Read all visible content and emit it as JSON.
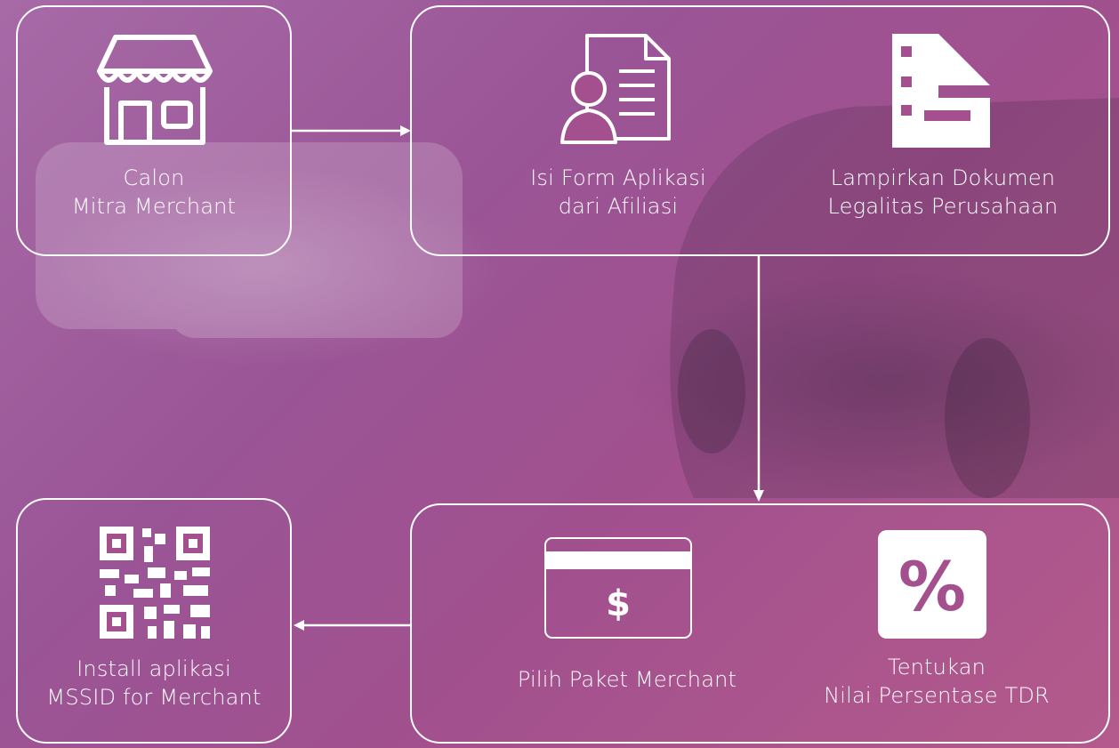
{
  "steps": {
    "calon": {
      "line1": "Calon",
      "line2": "Mitra Merchant",
      "icon": "storefront-icon"
    },
    "isi_form": {
      "line1": "Isi Form Aplikasi",
      "line2": "dari Afiliasi",
      "icon": "form-document-icon"
    },
    "lampirkan": {
      "line1": "Lampirkan Dokumen",
      "line2": "Legalitas Perusahaan",
      "icon": "document-icon"
    },
    "pilih_paket": {
      "line1": "Pilih Paket Merchant",
      "icon": "credit-card-icon"
    },
    "tentukan": {
      "line1": "Tentukan",
      "line2": "Nilai Persentase TDR",
      "icon": "percent-icon"
    },
    "install": {
      "line1": "Install aplikasi",
      "line2": "MSSID for Merchant",
      "icon": "qr-code-icon"
    }
  },
  "colors": {
    "line": "#ffffff",
    "accent": "#a4508f"
  }
}
